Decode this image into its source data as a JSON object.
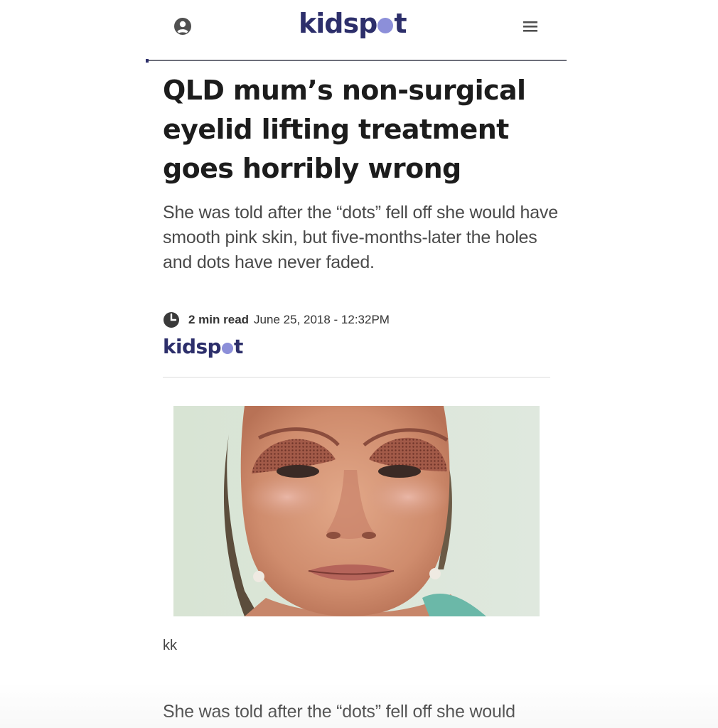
{
  "header": {
    "logo": {
      "text_before_dot": "kidsp",
      "text_after_dot": "t"
    },
    "icons": {
      "user": "user-account-icon",
      "menu": "hamburger-menu-icon"
    },
    "colors": {
      "brand_navy": "#2d2f6b",
      "brand_dot": "#8c8fd9"
    }
  },
  "article": {
    "headline": "QLD mum’s non-surgical eyelid lifting treatment goes horribly wrong",
    "standfirst": "She was told after the “dots” fell off she would have smooth pink skin, but five-months-later the holes and dots have never faded.",
    "meta": {
      "icon": "clock-icon",
      "read_time": "2 min read",
      "date": "June 25, 2018 - 12:32PM"
    },
    "source_logo": {
      "text_before_dot": "kidsp",
      "text_after_dot": "t"
    },
    "photo": {
      "icon": "article-photo"
    },
    "caption": "kk",
    "body_first_line": "She was told after the “dots” fell off she would"
  }
}
